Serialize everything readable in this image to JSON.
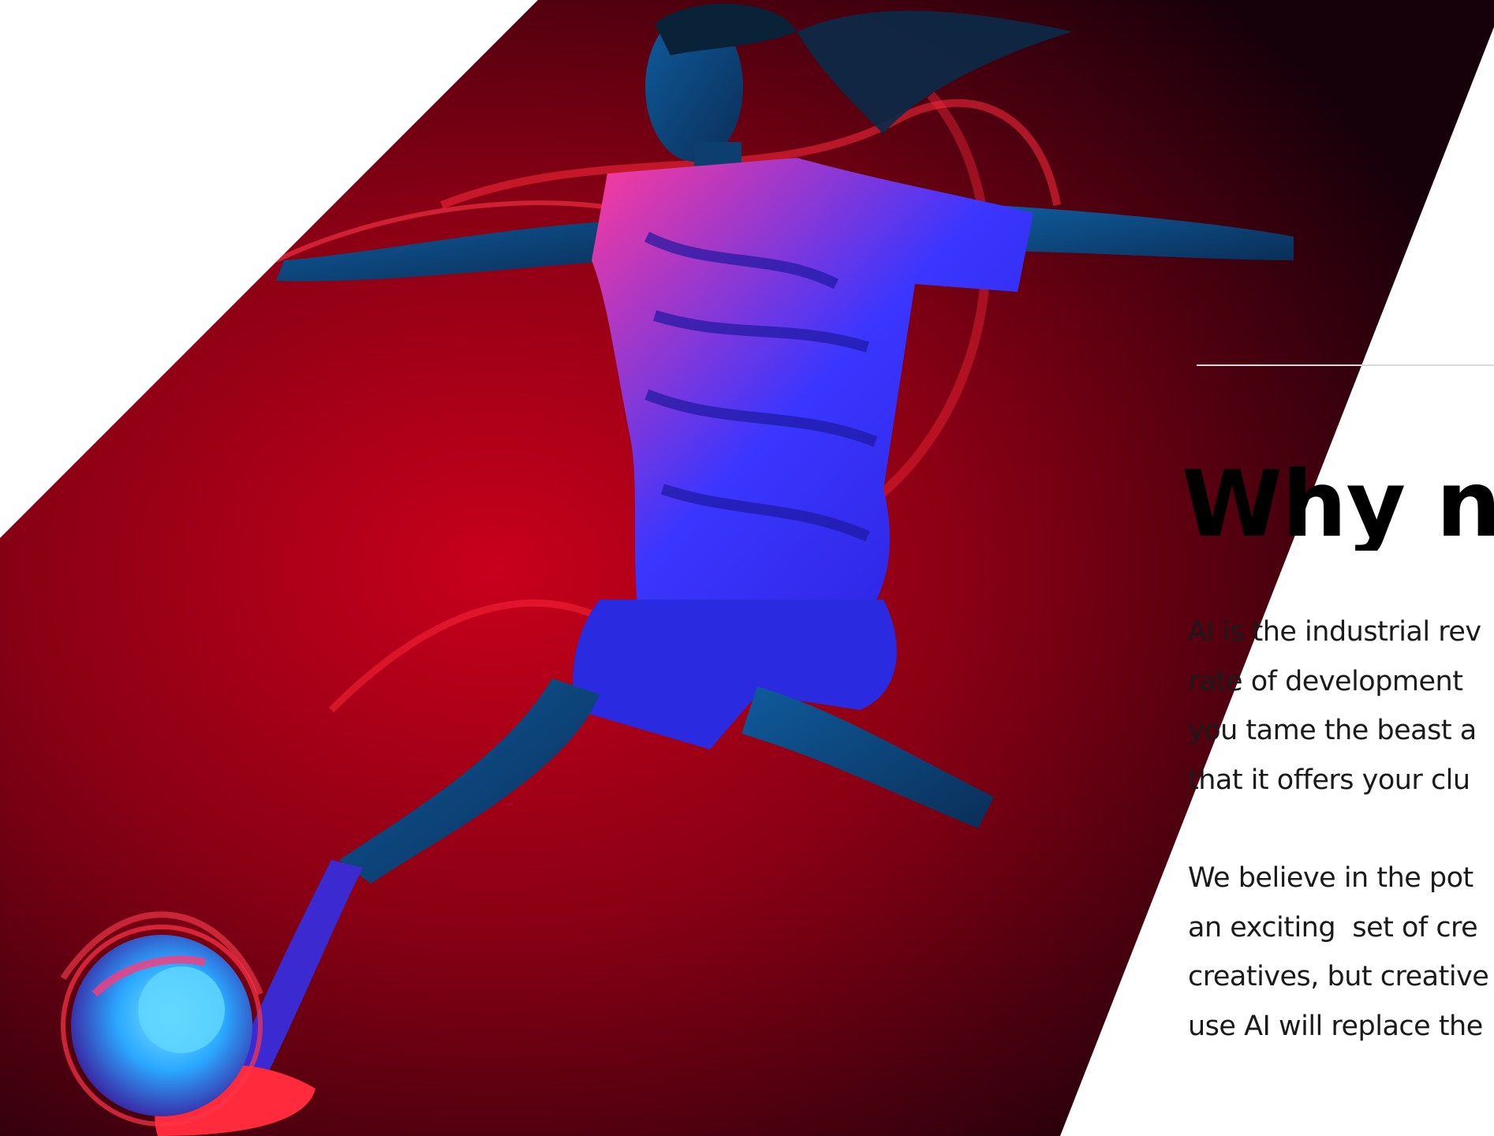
{
  "hero": {
    "image": "footballer-kicking-ball-neon-illustration",
    "colors": {
      "background_red": "#c0001a",
      "background_dark": "#1a0006",
      "neon_red": "#ff2a3c",
      "jersey_blue": "#2b3cff",
      "skin_blue": "#0e4d86"
    }
  },
  "section": {
    "title": "Why no",
    "paragraphs": [
      [
        "AI is the industrial rev",
        "rate of development",
        "you tame the beast a",
        "that it offers your clu"
      ],
      [
        "We believe in the pot",
        "an exciting  set of cre",
        "creatives, but creative",
        "use AI will replace the"
      ]
    ]
  },
  "colors": {
    "divider": "#d9d9d9",
    "text": "#1a1a1a",
    "heading": "#000000"
  }
}
